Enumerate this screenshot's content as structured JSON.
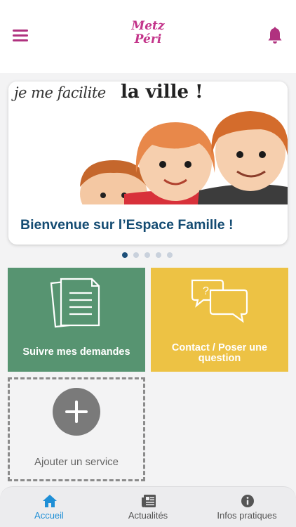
{
  "header": {
    "logo_line1": "Metz",
    "logo_line2": "Péri",
    "menu_icon": "hamburger-menu-icon",
    "notification_icon": "bell-icon",
    "accent_color": "#c3348a"
  },
  "carousel": {
    "banner_text_1": "je me facilite",
    "banner_text_2": "la ville !",
    "title": "Bienvenue sur l’Espace Famille !",
    "active_index": 0,
    "slide_count": 5
  },
  "tiles": {
    "requests_label": "Suivre mes demandes",
    "contact_label": "Contact / Poser une question",
    "add_label": "Ajouter un service",
    "colors": {
      "green": "#579471",
      "yellow": "#edc244"
    }
  },
  "tabbar": {
    "tabs": [
      {
        "label": "Accueil",
        "icon": "home-icon",
        "active": true
      },
      {
        "label": "Actualités",
        "icon": "newspaper-icon",
        "active": false
      },
      {
        "label": "Infos pratiques",
        "icon": "info-icon",
        "active": false
      }
    ],
    "active_color": "#1f8fd6"
  }
}
